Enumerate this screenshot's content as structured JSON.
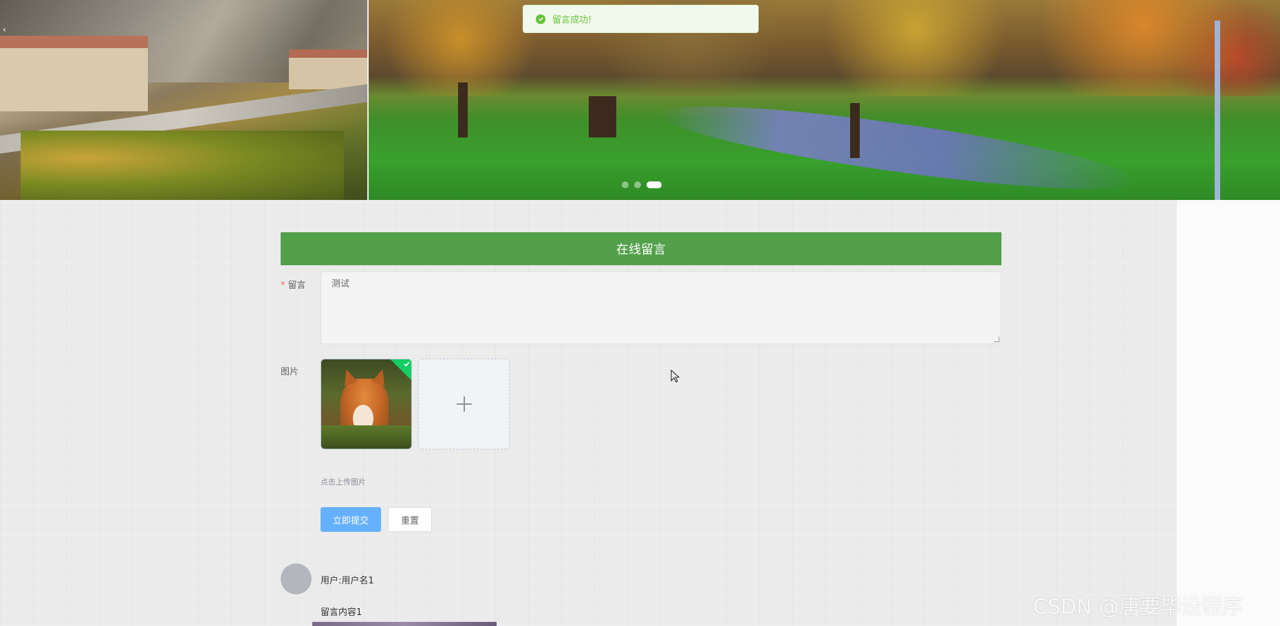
{
  "toast": {
    "message": "留言成功!"
  },
  "carousel": {
    "arrow_left": "‹",
    "slides": 3,
    "active_slide": 3
  },
  "form": {
    "title": "在线留言",
    "message_label": "留言",
    "message_value": "测试",
    "image_label": "图片",
    "upload_hint": "点击上传图片",
    "submit_label": "立即提交",
    "reset_label": "重置"
  },
  "comments": [
    {
      "user": "用户:用户名1",
      "content": "留言内容1"
    }
  ],
  "watermark": "CSDN @唐要毕设程序",
  "colors": {
    "title_bar": "#53a04a",
    "primary_button": "#66b1ff",
    "success": "#67c23a",
    "required": "#f56c6c"
  },
  "icons": {
    "toast_icon": "check-circle-icon",
    "upload_success_icon": "check-icon",
    "upload_add_icon": "plus-icon",
    "cursor_icon": "mouse-pointer-icon"
  }
}
